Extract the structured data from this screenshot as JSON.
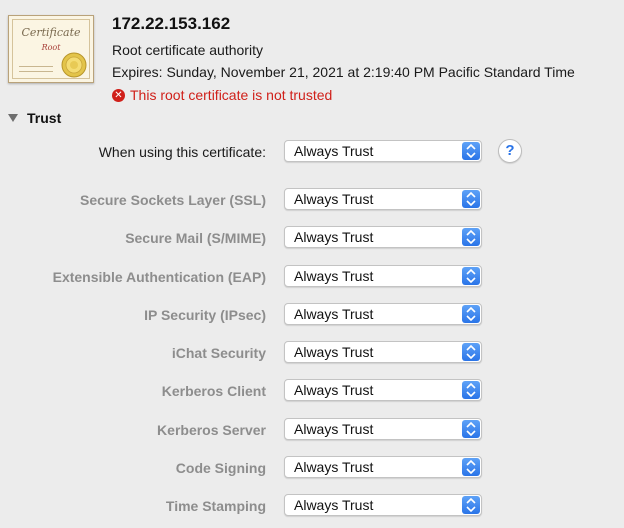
{
  "certificate": {
    "icon_text": "Certificate",
    "icon_sub": "Root",
    "name": "172.22.153.162",
    "kind": "Root certificate authority",
    "expires": "Expires: Sunday, November 21, 2021 at 2:19:40 PM Pacific Standard Time",
    "warning": "This root certificate is not trusted"
  },
  "trust": {
    "section_label": "Trust",
    "main_label": "When using this certificate:",
    "main_value": "Always Trust",
    "help_label": "?",
    "rows": [
      {
        "label": "Secure Sockets Layer (SSL)",
        "value": "Always Trust"
      },
      {
        "label": "Secure Mail (S/MIME)",
        "value": "Always Trust"
      },
      {
        "label": "Extensible Authentication (EAP)",
        "value": "Always Trust"
      },
      {
        "label": "IP Security (IPsec)",
        "value": "Always Trust"
      },
      {
        "label": "iChat Security",
        "value": "Always Trust"
      },
      {
        "label": "Kerberos Client",
        "value": "Always Trust"
      },
      {
        "label": "Kerberos Server",
        "value": "Always Trust"
      },
      {
        "label": "Code Signing",
        "value": "Always Trust"
      },
      {
        "label": "Time Stamping",
        "value": "Always Trust"
      }
    ]
  },
  "colors": {
    "warning": "#d0201a",
    "accent": "#2a74e8",
    "disabled_label": "#8d8d8d"
  }
}
